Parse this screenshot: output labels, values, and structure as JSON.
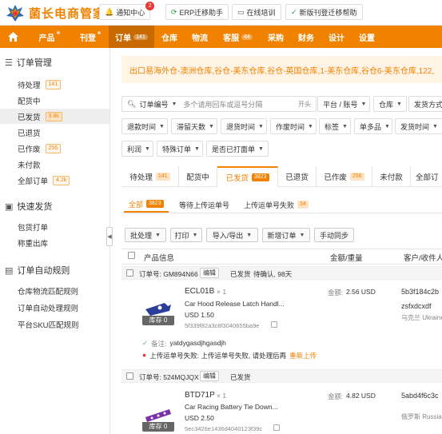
{
  "header": {
    "app_name": "菌长电商管家",
    "buttons": [
      {
        "icon": "bell-icon",
        "label": "通知中心",
        "badge": "2"
      },
      {
        "icon": "refresh-icon",
        "label": "ERP迁移助手"
      },
      {
        "icon": "monitor-icon",
        "label": "在线培训"
      },
      {
        "icon": "check-icon",
        "label": "新版刊登迁移帮助"
      }
    ]
  },
  "nav": {
    "home_icon": "home-icon",
    "items": [
      {
        "label": "产品"
      },
      {
        "label": "刊登"
      },
      {
        "label": "订单",
        "count": "141"
      },
      {
        "label": "仓库"
      },
      {
        "label": "物流"
      },
      {
        "label": "客服",
        "count": "44"
      },
      {
        "label": "采购"
      },
      {
        "label": "财务"
      },
      {
        "label": "设计"
      },
      {
        "label": "设置"
      }
    ]
  },
  "sidebar": {
    "order_mgmt": {
      "title": "订单管理",
      "items": [
        {
          "label": "待处理",
          "count": "141"
        },
        {
          "label": "配货中"
        },
        {
          "label": "已发货",
          "count": "3.8k"
        },
        {
          "label": "已退货"
        },
        {
          "label": "已作废",
          "count": "256"
        },
        {
          "label": "未付款"
        },
        {
          "label": "全部订单",
          "count": "4.2k"
        }
      ]
    },
    "quick_ship": {
      "title": "快速发货",
      "items": [
        {
          "label": "包货打单"
        },
        {
          "label": "称重出库"
        }
      ]
    },
    "auto_rules": {
      "title": "订单自动规则",
      "items": [
        {
          "label": "仓库物流匹配规则"
        },
        {
          "label": "订单自动处理规则"
        },
        {
          "label": "平台SKU匹配规则"
        }
      ]
    }
  },
  "notice": "出口易海外仓-澳洲仓库,谷仓-美东仓库,谷仓-英国仓库,1-美东仓库,谷仓6-美东仓库,122,",
  "filters": {
    "search_field": "订单编号",
    "search_placeholder": "多个请用回车或逗号分隔",
    "search_mode": "开头",
    "row1": [
      "平台 / 账号",
      "仓库",
      "发货方式"
    ],
    "row2": [
      "退款时间",
      "滞留天数",
      "退货时间",
      "作废时间",
      "标签",
      "单多品",
      "发货时间"
    ],
    "row3": [
      "利润",
      "特殊订单",
      "是否已打面单"
    ]
  },
  "tabs": [
    {
      "label": "待处理",
      "count": "141"
    },
    {
      "label": "配货中"
    },
    {
      "label": "已发货",
      "count": "3823"
    },
    {
      "label": "已退货"
    },
    {
      "label": "已作废",
      "count": "256"
    },
    {
      "label": "未付款"
    },
    {
      "label": "全部订"
    }
  ],
  "subtabs": [
    {
      "label": "全部",
      "count": "3823"
    },
    {
      "label": "等待上传运单号"
    },
    {
      "label": "上传运单号失败",
      "count": "34"
    }
  ],
  "actions": [
    {
      "label": "批处理"
    },
    {
      "label": "打印"
    },
    {
      "label": "导入/导出"
    },
    {
      "label": "新增订单"
    },
    {
      "label": "手动同步"
    }
  ],
  "table": {
    "headers": [
      "产品信息",
      "金额/重量",
      "客户/收件人"
    ]
  },
  "orders": [
    {
      "order_no": "订单号: GM894N66",
      "edit_label": "编辑",
      "status": "已发货",
      "extra": "待确认, 98天",
      "sku": "ECL01B",
      "qty": "× 1",
      "title": "Car Hood Release Latch Handl...",
      "price": "USD 1.50",
      "hash": "5f339f82a3c8f3040655ba9e",
      "stock": "库存 0",
      "amount_label": "金额:",
      "amount": "2.56 USD",
      "customer_id": "5b3f184c2b",
      "customer_name": "zsfxdcxdf",
      "country": "乌克兰 Ukraine",
      "note_label": "备注:",
      "note": "yatdygasdjhgasdjh",
      "error": "上传运单号失败: 上传运单号失败, 请处理后再",
      "retry": "重新上传",
      "thumb_color": "#2a3d9a"
    },
    {
      "order_no": "订单号: 524MQJQX",
      "edit_label": "编辑",
      "status": "已发货",
      "sku": "BTD71P",
      "qty": "× 1",
      "title": "Car Racing Battery Tie Down...",
      "price": "USD 2.50",
      "hash": "5ec3426e1436d4040123f39c",
      "stock": "库存 0",
      "amount_label": "金额:",
      "amount": "4.82 USD",
      "customer_id": "5abd4f6c3c",
      "country": "俄罗斯 Russia",
      "thumb_color": "#7b2fa8"
    }
  ],
  "colors": {
    "accent": "#f08200",
    "nav_active": "#c86a00",
    "notice_bg": "#fff4e6",
    "error": "#e53935"
  }
}
